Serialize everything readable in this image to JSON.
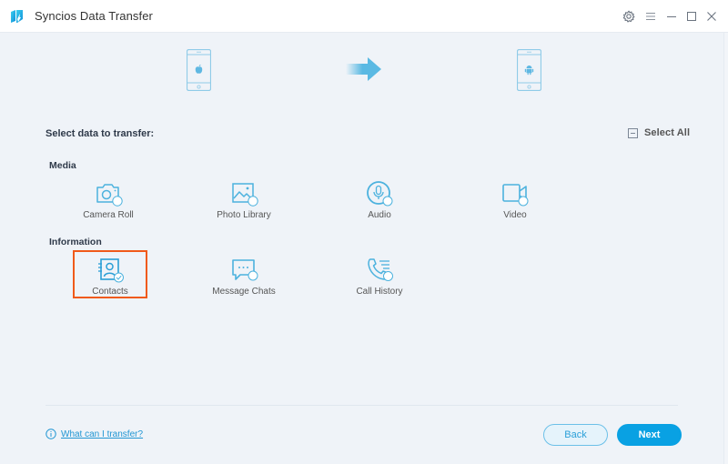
{
  "window": {
    "title": "Syncios Data Transfer",
    "controls": [
      {
        "name": "settings",
        "icon": "gear-icon"
      },
      {
        "name": "menu",
        "icon": "hamburger-menu-icon"
      },
      {
        "name": "minimize",
        "icon": "minimize-icon"
      },
      {
        "name": "maximize",
        "icon": "maximize-icon"
      },
      {
        "name": "close",
        "icon": "close-icon"
      }
    ]
  },
  "transfer": {
    "source": {
      "platform": "iOS",
      "icon": "apple-icon"
    },
    "target": {
      "platform": "Android",
      "icon": "android-icon"
    },
    "direction_icon": "arrow-right-icon"
  },
  "selection": {
    "title": "Select data to transfer:",
    "select_all_label": "Select All"
  },
  "sections": [
    {
      "label": "Media",
      "items": [
        {
          "label": "Camera Roll",
          "icon": "camera-icon",
          "selected": false
        },
        {
          "label": "Photo Library",
          "icon": "photo-icon",
          "selected": false
        },
        {
          "label": "Audio",
          "icon": "microphone-icon",
          "selected": false
        },
        {
          "label": "Video",
          "icon": "video-camera-icon",
          "selected": false
        }
      ]
    },
    {
      "label": "Information",
      "items": [
        {
          "label": "Contacts",
          "icon": "contacts-icon",
          "selected": true
        },
        {
          "label": "Message Chats",
          "icon": "message-icon",
          "selected": false
        },
        {
          "label": "Call History",
          "icon": "call-history-icon",
          "selected": false
        }
      ]
    }
  ],
  "footer": {
    "help_link": "What can I transfer?",
    "back_label": "Back",
    "next_label": "Next"
  },
  "colors": {
    "accent": "#09a1e3",
    "icon": "#4cb2de",
    "highlight": "#f05a1a",
    "background": "#eff3f8"
  }
}
